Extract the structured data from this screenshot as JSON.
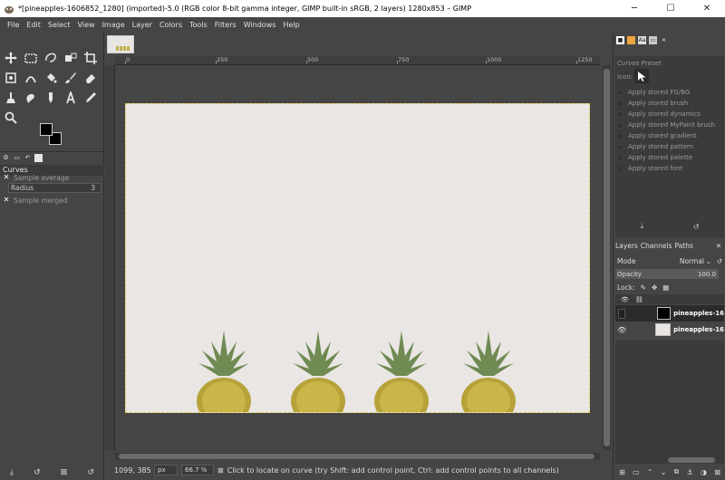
{
  "window": {
    "title": "*[pineapples-1606852_1280] (imported)-5.0 (RGB color 8-bit gamma integer, GIMP built-in sRGB, 2 layers) 1280x853 – GIMP",
    "minimize": "─",
    "maximize": "☐",
    "close": "✕"
  },
  "menu": [
    "File",
    "Edit",
    "Select",
    "View",
    "Image",
    "Layer",
    "Colors",
    "Tools",
    "Filters",
    "Windows",
    "Help"
  ],
  "tool_options": {
    "title": "Curves",
    "sample_average": "Sample average",
    "radius_label": "Radius",
    "radius_value": "3",
    "sample_merged": "Sample merged"
  },
  "ruler": {
    "h_labels": [
      "0",
      "250",
      "500",
      "750",
      "1000",
      "1250"
    ]
  },
  "status": {
    "coords": "1099, 385",
    "unit": "px",
    "zoom": "66.7 %",
    "message": "Click to locate on curve (try Shift: add control point, Ctrl: add control points to all channels)"
  },
  "presets": {
    "title": "Curves Preset",
    "icon_label": "Icon:",
    "items": [
      "Apply stored FG/BG",
      "Apply stored brush",
      "Apply stored dynamics",
      "Apply stored MyPaint brush",
      "Apply stored gradient",
      "Apply stored pattern",
      "Apply stored palette",
      "Apply stored font"
    ]
  },
  "layers_dock": {
    "tabs": [
      "Layers",
      "Channels",
      "Paths"
    ],
    "mode_label": "Mode",
    "mode_value": "Normal",
    "opacity_label": "Opacity",
    "opacity_value": "100.0",
    "lock_label": "Lock:",
    "layers": [
      {
        "name": "pineapples-16",
        "visible": false,
        "selected": true
      },
      {
        "name": "pineapples-16",
        "visible": true,
        "selected": false
      }
    ]
  },
  "colors": {
    "canvas_bg": "#e9e6e4",
    "selection_border": "#e5d25a",
    "ui_bg": "#454545"
  }
}
